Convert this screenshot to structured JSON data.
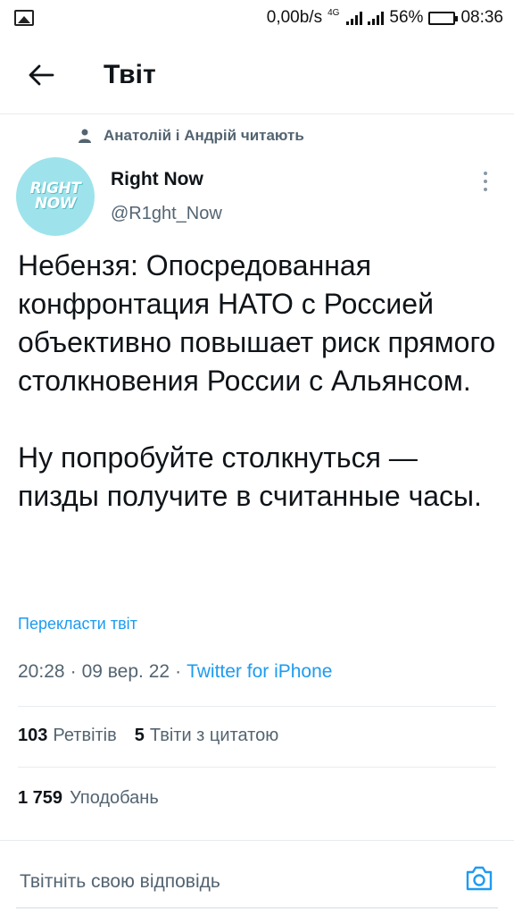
{
  "status_bar": {
    "network_speed": "0,00b/s",
    "network_type": "4G",
    "battery": "56%",
    "battery_level": 0.56,
    "time": "08:36"
  },
  "header": {
    "title": "Твіт",
    "back_icon": "arrow-left-icon"
  },
  "context": {
    "icon": "person-icon",
    "text": "Анатолій і Андрій читають"
  },
  "author": {
    "avatar_lines": [
      "RIGHT",
      "NOW"
    ],
    "name": "Right Now",
    "handle": "@R1ght_Now"
  },
  "tweet": {
    "text": "Небензя: Опосредованная конфронтация НАТО с Россией объективно повышает риск прямого столкновения России с Альянсом.\n\nНу попробуйте столкнуться — пизды получите в считанные часы.",
    "translate_label": "Перекласти твіт",
    "time": "20:28",
    "date": "09 вер. 22",
    "separator": "·",
    "source": "Twitter for iPhone"
  },
  "stats": {
    "retweets_count": "103",
    "retweets_label": "Ретвітів",
    "quotes_count": "5",
    "quotes_label": "Твіти з цитатою",
    "likes_count": "1 759",
    "likes_label": "Уподобань"
  },
  "reply": {
    "placeholder": "Твітніть свою відповідь",
    "camera_icon": "camera-icon"
  },
  "colors": {
    "accent": "#1d9bf0",
    "secondary_text": "#536471",
    "avatar_bg": "#9ee3eb"
  }
}
